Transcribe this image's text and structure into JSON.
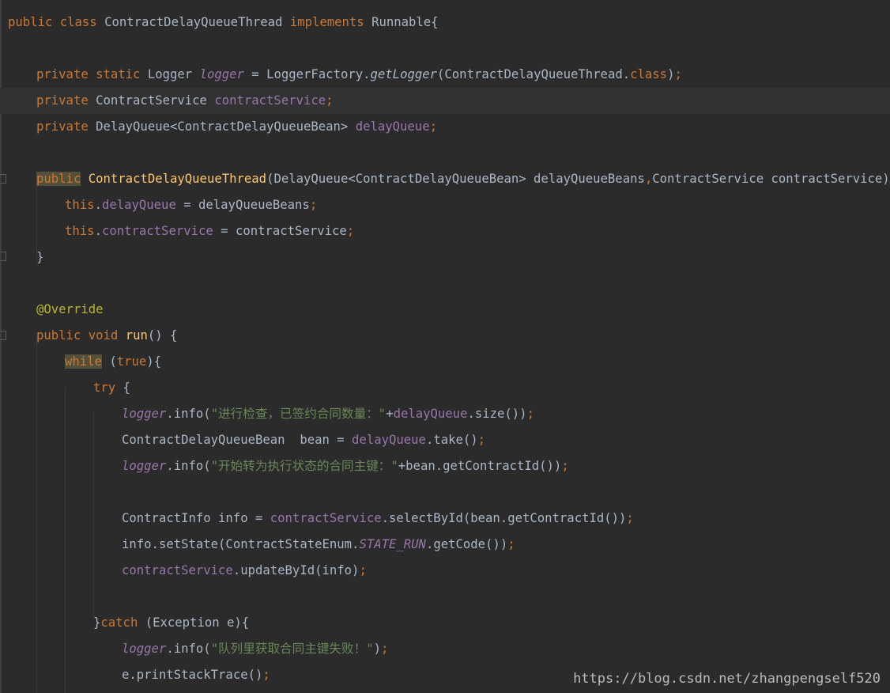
{
  "code_lines": [
    {
      "indent": 0,
      "tokens": [
        {
          "t": "public",
          "c": "kw"
        },
        {
          "t": " ",
          "c": "plain"
        },
        {
          "t": "class",
          "c": "kw"
        },
        {
          "t": " ContractDelayQueueThread ",
          "c": "plain"
        },
        {
          "t": "implements",
          "c": "kw"
        },
        {
          "t": " Runnable{",
          "c": "plain"
        }
      ]
    },
    {
      "indent": 0,
      "tokens": []
    },
    {
      "indent": 1,
      "tokens": [
        {
          "t": "private",
          "c": "kw"
        },
        {
          "t": " ",
          "c": "plain"
        },
        {
          "t": "static",
          "c": "kw"
        },
        {
          "t": " Logger ",
          "c": "plain"
        },
        {
          "t": "logger",
          "c": "sfld"
        },
        {
          "t": " = LoggerFactory.",
          "c": "plain"
        },
        {
          "t": "getLogger",
          "c": "smeth"
        },
        {
          "t": "(ContractDelayQueueThread.",
          "c": "plain"
        },
        {
          "t": "class",
          "c": "kw"
        },
        {
          "t": ")",
          "c": "plain"
        },
        {
          "t": ";",
          "c": "kw"
        }
      ]
    },
    {
      "indent": 1,
      "current": true,
      "tokens": [
        {
          "t": "private",
          "c": "kw"
        },
        {
          "t": " ContractService ",
          "c": "plain"
        },
        {
          "t": "contractService",
          "c": "fld"
        },
        {
          "t": ";",
          "c": "kw"
        }
      ]
    },
    {
      "indent": 1,
      "tokens": [
        {
          "t": "private",
          "c": "kw"
        },
        {
          "t": " DelayQueue<ContractDelayQueueBean> ",
          "c": "plain"
        },
        {
          "t": "delayQueue",
          "c": "fld"
        },
        {
          "t": ";",
          "c": "kw"
        }
      ]
    },
    {
      "indent": 0,
      "tokens": []
    },
    {
      "indent": 1,
      "tokens": [
        {
          "t": "public",
          "c": "kw hl"
        },
        {
          "t": " ",
          "c": "plain"
        },
        {
          "t": "ContractDelayQueueThread",
          "c": "meth"
        },
        {
          "t": "(DelayQueue<ContractDelayQueueBean> delayQueueBeans",
          "c": "plain"
        },
        {
          "t": ",",
          "c": "kw"
        },
        {
          "t": "ContractService contractService){",
          "c": "plain"
        }
      ]
    },
    {
      "indent": 2,
      "tokens": [
        {
          "t": "this",
          "c": "kw"
        },
        {
          "t": ".",
          "c": "plain"
        },
        {
          "t": "delayQueue",
          "c": "fld"
        },
        {
          "t": " = delayQueueBeans",
          "c": "plain"
        },
        {
          "t": ";",
          "c": "kw"
        }
      ]
    },
    {
      "indent": 2,
      "tokens": [
        {
          "t": "this",
          "c": "kw"
        },
        {
          "t": ".",
          "c": "plain"
        },
        {
          "t": "contractService",
          "c": "fld"
        },
        {
          "t": " = contractService",
          "c": "plain"
        },
        {
          "t": ";",
          "c": "kw"
        }
      ]
    },
    {
      "indent": 1,
      "tokens": [
        {
          "t": "}",
          "c": "plain"
        }
      ]
    },
    {
      "indent": 0,
      "tokens": []
    },
    {
      "indent": 1,
      "tokens": [
        {
          "t": "@Override",
          "c": "ann"
        }
      ]
    },
    {
      "indent": 1,
      "tokens": [
        {
          "t": "public",
          "c": "kw"
        },
        {
          "t": " ",
          "c": "plain"
        },
        {
          "t": "void",
          "c": "kw"
        },
        {
          "t": " ",
          "c": "plain"
        },
        {
          "t": "run",
          "c": "meth"
        },
        {
          "t": "() {",
          "c": "plain"
        }
      ]
    },
    {
      "indent": 2,
      "tokens": [
        {
          "t": "while",
          "c": "kw hl"
        },
        {
          "t": " (",
          "c": "plain"
        },
        {
          "t": "true",
          "c": "kw"
        },
        {
          "t": "){",
          "c": "plain"
        }
      ]
    },
    {
      "indent": 3,
      "tokens": [
        {
          "t": "try",
          "c": "kw"
        },
        {
          "t": " {",
          "c": "plain"
        }
      ]
    },
    {
      "indent": 4,
      "tokens": [
        {
          "t": "logger",
          "c": "sfld"
        },
        {
          "t": ".info(",
          "c": "plain"
        },
        {
          "t": "\"进行检查，已签约合同数量：\"",
          "c": "str"
        },
        {
          "t": "+",
          "c": "plain"
        },
        {
          "t": "delayQueue",
          "c": "fld"
        },
        {
          "t": ".size())",
          "c": "plain"
        },
        {
          "t": ";",
          "c": "kw"
        }
      ]
    },
    {
      "indent": 4,
      "tokens": [
        {
          "t": "ContractDelayQueueBean  bean = ",
          "c": "plain"
        },
        {
          "t": "delayQueue",
          "c": "fld"
        },
        {
          "t": ".take()",
          "c": "plain"
        },
        {
          "t": ";",
          "c": "kw"
        }
      ]
    },
    {
      "indent": 4,
      "tokens": [
        {
          "t": "logger",
          "c": "sfld"
        },
        {
          "t": ".info(",
          "c": "plain"
        },
        {
          "t": "\"开始转为执行状态的合同主键：\"",
          "c": "str"
        },
        {
          "t": "+bean.getContractId())",
          "c": "plain"
        },
        {
          "t": ";",
          "c": "kw"
        }
      ]
    },
    {
      "indent": 0,
      "tokens": []
    },
    {
      "indent": 4,
      "tokens": [
        {
          "t": "ContractInfo info = ",
          "c": "plain"
        },
        {
          "t": "contractService",
          "c": "fld"
        },
        {
          "t": ".selectById(bean.getContractId())",
          "c": "plain"
        },
        {
          "t": ";",
          "c": "kw"
        }
      ]
    },
    {
      "indent": 4,
      "tokens": [
        {
          "t": "info.setState(ContractStateEnum.",
          "c": "plain"
        },
        {
          "t": "STATE_RUN",
          "c": "sfld"
        },
        {
          "t": ".getCode())",
          "c": "plain"
        },
        {
          "t": ";",
          "c": "kw"
        }
      ]
    },
    {
      "indent": 4,
      "tokens": [
        {
          "t": "contractService",
          "c": "fld"
        },
        {
          "t": ".updateById(info)",
          "c": "plain"
        },
        {
          "t": ";",
          "c": "kw"
        }
      ]
    },
    {
      "indent": 0,
      "tokens": []
    },
    {
      "indent": 3,
      "tokens": [
        {
          "t": "}",
          "c": "plain"
        },
        {
          "t": "catch",
          "c": "kw"
        },
        {
          "t": " (Exception e){",
          "c": "plain"
        }
      ]
    },
    {
      "indent": 4,
      "tokens": [
        {
          "t": "logger",
          "c": "sfld"
        },
        {
          "t": ".info(",
          "c": "plain"
        },
        {
          "t": "\"队列里获取合同主键失败！\"",
          "c": "str"
        },
        {
          "t": ")",
          "c": "plain"
        },
        {
          "t": ";",
          "c": "kw"
        }
      ]
    },
    {
      "indent": 4,
      "tokens": [
        {
          "t": "e.printStackTrace()",
          "c": "plain"
        },
        {
          "t": ";",
          "c": "kw"
        }
      ]
    }
  ],
  "watermark": "https://blog.csdn.net/zhangpengself520",
  "colors": {
    "background": "#2b2b2b",
    "keyword": "#cc7832",
    "field": "#9876aa",
    "string": "#6a8759",
    "method": "#ffc66d",
    "annotation": "#bbb529",
    "text": "#a9b7c6"
  }
}
